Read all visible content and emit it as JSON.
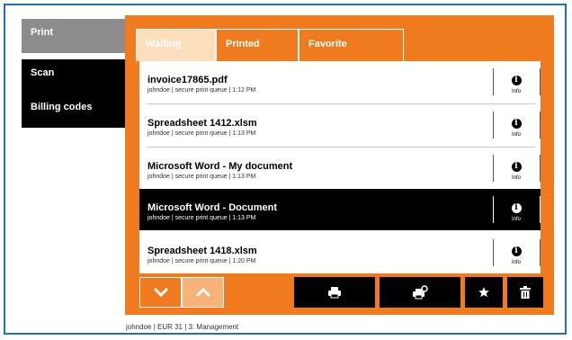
{
  "sidebar": {
    "items": [
      {
        "label": "Print",
        "active": true
      },
      {
        "label": "Scan",
        "active": false
      },
      {
        "label": "Billing codes",
        "active": false
      }
    ]
  },
  "tabs": [
    {
      "label": "Waiting",
      "active": true
    },
    {
      "label": "Printed",
      "active": false
    },
    {
      "label": "Favorite",
      "active": false
    }
  ],
  "jobs": [
    {
      "title": "invoice17865.pdf",
      "subtitle": "johndoe | secure print queue | 1:12 PM",
      "info_label": "Info",
      "selected": false
    },
    {
      "title": "Spreadsheet 1412.xlsm",
      "subtitle": "johndoe | secure print queue | 1:13 PM",
      "info_label": "Info",
      "selected": false
    },
    {
      "title": "Microsoft Word - My document",
      "subtitle": "johndoe | secure print queue | 1:13 PM",
      "info_label": "Info",
      "selected": false
    },
    {
      "title": "Microsoft Word - Document",
      "subtitle": "johndoe | secure print queue | 1:13 PM",
      "info_label": "Info",
      "selected": true
    },
    {
      "title": "Spreadsheet 1418.xlsm",
      "subtitle": "johndoe | secure print queue | 1:20 PM",
      "info_label": "Info",
      "selected": false
    }
  ],
  "toolbar": {
    "scroll_down_icon": "chevron-down-icon",
    "scroll_up_icon": "chevron-up-icon",
    "print_icon": "printer-icon",
    "print_keep_icon": "print-and-keep-icon",
    "favorite_icon": "star-icon",
    "delete_icon": "trash-icon"
  },
  "footer": {
    "text": "johndoe | EUR 31 | 3: Management"
  },
  "colors": {
    "accent": "#f07a1e",
    "accent_light": "#fddfbe",
    "frame": "#1f73a8",
    "selected_row": "#000000",
    "sidebar_active": "#8c8c8c"
  }
}
